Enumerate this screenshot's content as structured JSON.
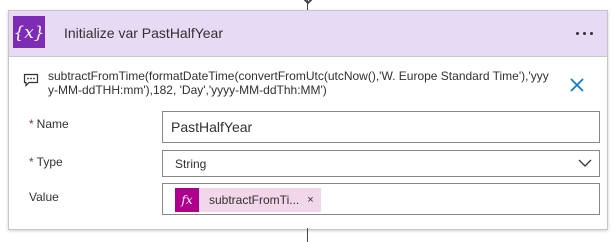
{
  "action": {
    "icon": "curly-braces-x-icon",
    "icon_glyph": "{x}",
    "title": "Initialize var PastHalfYear",
    "more_label": "...",
    "header_color": "#e7daf5",
    "icon_color": "#7e2bb6"
  },
  "comment": {
    "icon": "comment-icon",
    "text": "subtractFromTime(formatDateTime(convertFromUtc(utcNow(),'W. Europe Standard Time'),'yyyy-MM-ddTHH:mm'),182, 'Day','yyyy-MM-ddThh:MM')",
    "close_icon": "close-icon"
  },
  "fields": {
    "name": {
      "required_mark": "*",
      "label": "Name",
      "value": "PastHalfYear"
    },
    "type": {
      "required_mark": "*",
      "label": "Type",
      "value": "String",
      "dropdown_icon": "chevron-down-icon"
    },
    "value": {
      "label": "Value",
      "token": {
        "icon": "fx-icon",
        "icon_glyph": "fx",
        "label": "subtractFromTi...",
        "remove": "×",
        "color": "#ad008c",
        "background": "#f2d6e9"
      }
    }
  }
}
